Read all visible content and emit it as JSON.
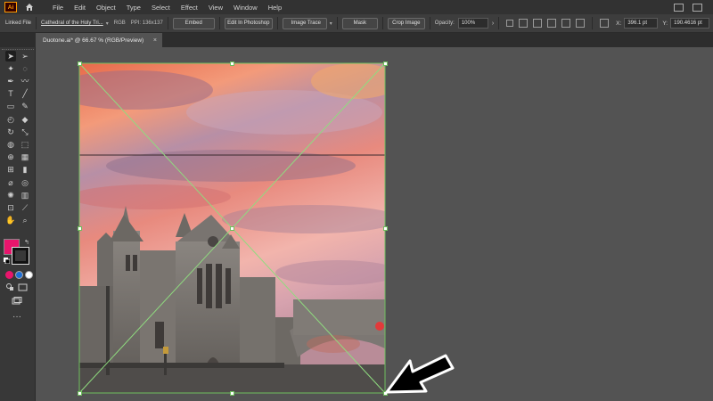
{
  "app": {
    "logo": "Ai",
    "menu": [
      "File",
      "Edit",
      "Object",
      "Type",
      "Select",
      "Effect",
      "View",
      "Window",
      "Help"
    ]
  },
  "control_bar": {
    "type_label": "Linked File",
    "file_link": "Cathedral of the Holy Tri...",
    "color_mode": "RGB",
    "ppi": "PPI: 136x137",
    "embed_label": "Embed",
    "edit_photoshop_label": "Edit In Photoshop",
    "image_trace_label": "Image Trace",
    "mask_label": "Mask",
    "crop_label": "Crop Image",
    "opacity_label": "Opacity:",
    "opacity_value": "100%",
    "x_label": "X:",
    "x_value": "396.1 pt",
    "y_label": "Y:",
    "y_value": "190.4616 pt"
  },
  "document": {
    "tab_title": "Duotone.ai* @ 66.67 % (RGB/Preview)",
    "close_glyph": "×"
  },
  "colors": {
    "fill": "#e8156c",
    "selection": "#6fbf5f",
    "accent_blue": "#2f7fd6"
  },
  "icons": [
    "selection-tool",
    "direct-selection-tool",
    "magic-wand-tool",
    "lasso-tool",
    "pen-tool",
    "curvature-tool",
    "type-tool",
    "line-segment-tool",
    "rectangle-tool",
    "paintbrush-tool",
    "shaper-tool",
    "eraser-tool",
    "rotate-tool",
    "scale-tool",
    "warp-tool",
    "free-transform-tool",
    "shape-builder-tool",
    "perspective-grid-tool",
    "mesh-tool",
    "gradient-tool",
    "eyedropper-tool",
    "blend-tool",
    "symbol-sprayer-tool",
    "column-graph-tool",
    "artboard-tool",
    "slice-tool",
    "hand-tool",
    "zoom-tool"
  ]
}
